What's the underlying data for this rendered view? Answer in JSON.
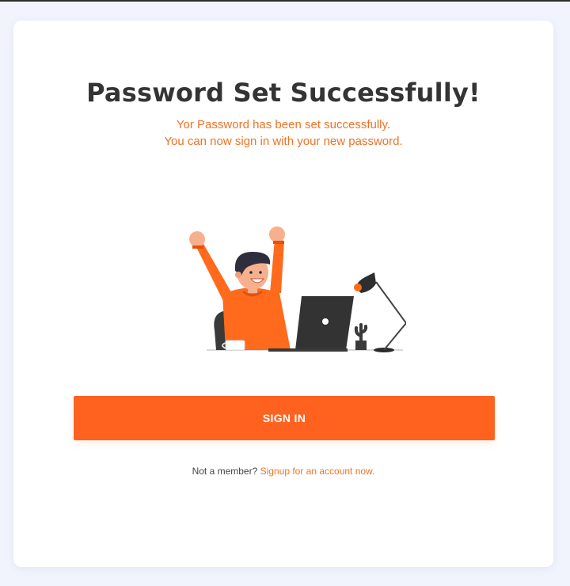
{
  "page": {
    "title": "Password Set Successfully!",
    "message_line1": "Yor Password has been set successfully.",
    "message_line2": "You can now sign in with your new password."
  },
  "actions": {
    "signin_label": "SIGN IN"
  },
  "footer": {
    "prompt": "Not a member?",
    "link_label": "Signup for an account now."
  },
  "colors": {
    "accent": "#ff621e",
    "message_text": "#f07226",
    "title_text": "#343434",
    "page_background": "#f1f4fd"
  },
  "illustration": {
    "icon": "celebrating-person-at-desk-illustration"
  }
}
